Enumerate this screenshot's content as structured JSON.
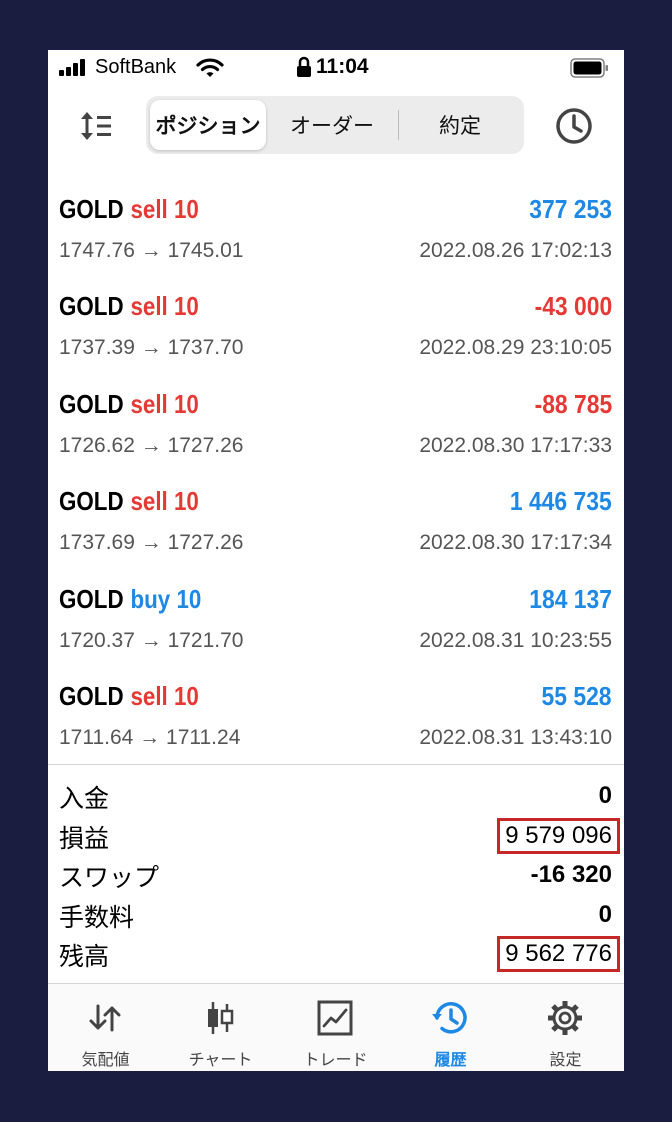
{
  "status_bar": {
    "carrier": "SoftBank",
    "time": "11:04"
  },
  "tabs_segment": [
    {
      "label": "ポジション",
      "active": true
    },
    {
      "label": "オーダー",
      "active": false
    },
    {
      "label": "約定",
      "active": false
    }
  ],
  "deals": [
    {
      "symbol": "GOLD",
      "side": "sell",
      "volume": "10",
      "profit": "377 253",
      "profit_color": "blue",
      "prices": "1747.76 → 1745.01",
      "datetime": "2022.08.26 17:02:13"
    },
    {
      "symbol": "GOLD",
      "side": "sell",
      "volume": "10",
      "profit": "-43 000",
      "profit_color": "red",
      "prices": "1737.39 → 1737.70",
      "datetime": "2022.08.29 23:10:05"
    },
    {
      "symbol": "GOLD",
      "side": "sell",
      "volume": "10",
      "profit": "-88 785",
      "profit_color": "red",
      "prices": "1726.62 → 1727.26",
      "datetime": "2022.08.30 17:17:33"
    },
    {
      "symbol": "GOLD",
      "side": "sell",
      "volume": "10",
      "profit": "1 446 735",
      "profit_color": "blue",
      "prices": "1737.69 → 1727.26",
      "datetime": "2022.08.30 17:17:34"
    },
    {
      "symbol": "GOLD",
      "side": "buy",
      "volume": "10",
      "profit": "184 137",
      "profit_color": "blue",
      "prices": "1720.37 → 1721.70",
      "datetime": "2022.08.31 10:23:55"
    },
    {
      "symbol": "GOLD",
      "side": "sell",
      "volume": "10",
      "profit": "55 528",
      "profit_color": "blue",
      "prices": "1711.64 → 1711.24",
      "datetime": "2022.08.31 13:43:10"
    }
  ],
  "summary": {
    "deposit_label": "入金",
    "deposit_value": "0",
    "profit_label": "損益",
    "profit_value": "9 579 096",
    "swap_label": "スワップ",
    "swap_value": "-16 320",
    "commission_label": "手数料",
    "commission_value": "0",
    "balance_label": "残高",
    "balance_value": "9 562 776"
  },
  "tab_bar": [
    {
      "label": "気配値",
      "icon": "quotes-arrows-icon",
      "active": false
    },
    {
      "label": "チャート",
      "icon": "candlestick-icon",
      "active": false
    },
    {
      "label": "トレード",
      "icon": "trade-chart-icon",
      "active": false
    },
    {
      "label": "履歴",
      "icon": "history-icon",
      "active": true
    },
    {
      "label": "設定",
      "icon": "gear-icon",
      "active": false
    }
  ],
  "colors": {
    "sell": "#e53935",
    "buy": "#1e88e5",
    "loss": "#e53935",
    "gain": "#1e88e5",
    "highlight_box": "#c62828",
    "background": "#1a1d3f"
  }
}
